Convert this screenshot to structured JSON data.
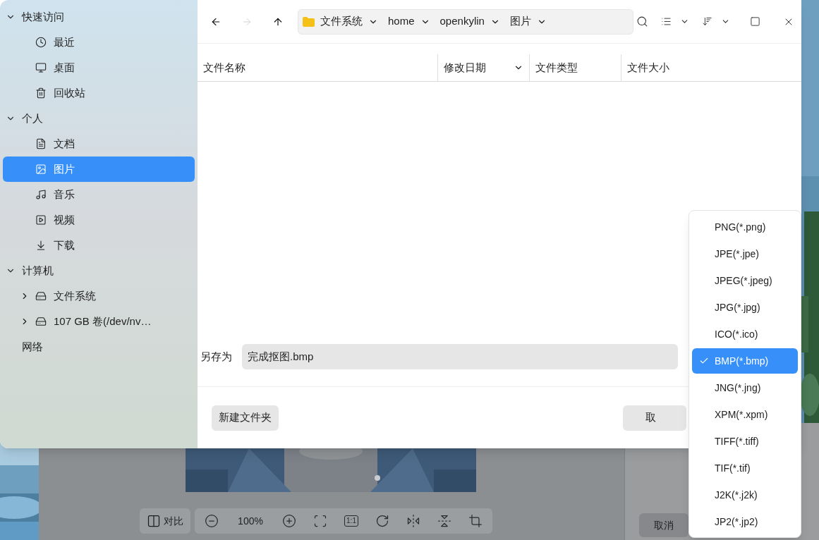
{
  "nav": [
    {
      "kind": "back",
      "disabled": false
    },
    {
      "kind": "forward",
      "disabled": true
    },
    {
      "kind": "up",
      "disabled": false
    }
  ],
  "breadcrumb": [
    "文件系统",
    "home",
    "openkylin",
    "图片"
  ],
  "sidebar": [
    {
      "kind": "section",
      "label": "快速访问",
      "expanded": true,
      "children": [
        {
          "label": "最近",
          "kind": "recent",
          "selected": false
        },
        {
          "label": "桌面",
          "kind": "desktop",
          "selected": false
        },
        {
          "label": "回收站",
          "kind": "trash",
          "selected": false
        }
      ]
    },
    {
      "kind": "section",
      "label": "个人",
      "expanded": true,
      "children": [
        {
          "label": "文档",
          "kind": "documents",
          "selected": false
        },
        {
          "label": "图片",
          "kind": "pictures",
          "selected": true
        },
        {
          "label": "音乐",
          "kind": "music",
          "selected": false
        },
        {
          "label": "视频",
          "kind": "videos",
          "selected": false
        },
        {
          "label": "下载",
          "kind": "downloads",
          "selected": false
        }
      ]
    },
    {
      "kind": "section",
      "label": "计算机",
      "expanded": true,
      "children": [
        {
          "label": "文件系统",
          "kind": "drive",
          "selected": false,
          "expanded": false
        },
        {
          "label": "107 GB 卷(/dev/nv…",
          "kind": "drive",
          "selected": false,
          "expanded": false
        }
      ]
    },
    {
      "kind": "label",
      "label": "网络"
    }
  ],
  "columns": [
    {
      "label": "文件名称",
      "sorted": false
    },
    {
      "label": "修改日期",
      "sorted": true
    },
    {
      "label": "文件类型",
      "sorted": false
    },
    {
      "label": "文件大小",
      "sorted": false
    }
  ],
  "save_as": {
    "label": "另存为",
    "value": "完成抠图.bmp"
  },
  "buttons": [
    {
      "kind": "new_folder",
      "label": "新建文件夹"
    },
    {
      "kind": "cancel",
      "label": "取"
    }
  ],
  "format_menu": [
    {
      "label": "PNG(*.png)",
      "selected": false
    },
    {
      "label": "JPE(*.jpe)",
      "selected": false
    },
    {
      "label": "JPEG(*.jpeg)",
      "selected": false
    },
    {
      "label": "JPG(*.jpg)",
      "selected": false
    },
    {
      "label": "ICO(*.ico)",
      "selected": false
    },
    {
      "label": "BMP(*.bmp)",
      "selected": true
    },
    {
      "label": "JNG(*.jng)",
      "selected": false
    },
    {
      "label": "XPM(*.xpm)",
      "selected": false
    },
    {
      "label": "TIFF(*.tiff)",
      "selected": false
    },
    {
      "label": "TIF(*.tif)",
      "selected": false
    },
    {
      "label": "J2K(*.j2k)",
      "selected": false
    },
    {
      "label": "JP2(*.jp2)",
      "selected": false
    }
  ],
  "editor_toolbar": [
    {
      "kind": "compare",
      "label": "对比"
    },
    {
      "kind": "zoom_out"
    },
    {
      "kind": "zoom",
      "label": "100%"
    },
    {
      "kind": "zoom_in"
    },
    {
      "kind": "fit"
    },
    {
      "kind": "actual_size",
      "label": "1:1"
    },
    {
      "kind": "rotate"
    },
    {
      "kind": "flip_horizontal"
    },
    {
      "kind": "flip_vertical"
    },
    {
      "kind": "crop"
    }
  ],
  "editor_cancel": "取消"
}
